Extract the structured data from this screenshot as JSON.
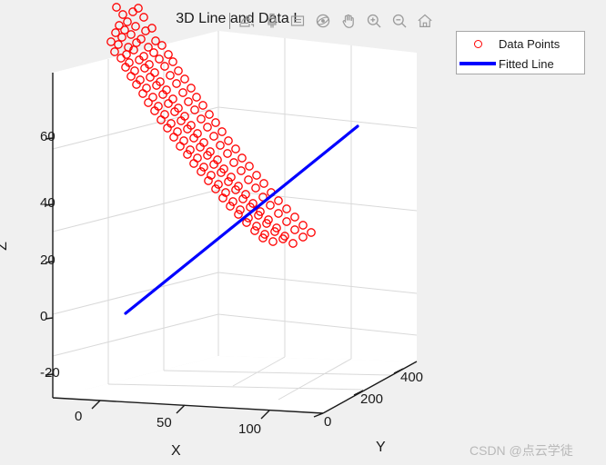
{
  "figure": {
    "background_color": "#f0f0f0",
    "title": "3D Line and Data I"
  },
  "toolbar": {
    "buttons": [
      {
        "name": "export-icon",
        "label": "Export"
      },
      {
        "name": "brush-icon",
        "label": "Brush/Select Data"
      },
      {
        "name": "datatip-icon",
        "label": "Data Tips"
      },
      {
        "name": "rotate3d-icon",
        "label": "Rotate 3D"
      },
      {
        "name": "pan-icon",
        "label": "Pan"
      },
      {
        "name": "zoom-in-icon",
        "label": "Zoom In"
      },
      {
        "name": "zoom-out-icon",
        "label": "Zoom Out"
      },
      {
        "name": "home-icon",
        "label": "Restore View"
      }
    ]
  },
  "legend": {
    "entries": [
      {
        "label": "Data Points",
        "marker": "circle",
        "color": "#ff0000"
      },
      {
        "label": "Fitted Line",
        "marker": "line",
        "color": "#0000ff"
      }
    ]
  },
  "watermark": {
    "text": "CSDN @点云学徒"
  },
  "chart_data": {
    "type": "scatter",
    "title": "3D Line and Data I",
    "xlabel": "X",
    "ylabel": "Y",
    "zlabel": "Z",
    "xlim": [
      -25,
      150
    ],
    "ylim": [
      -100,
      500
    ],
    "zlim": [
      -30,
      75
    ],
    "xticks": [
      0,
      50,
      100
    ],
    "yticks": [
      0,
      200,
      400
    ],
    "zticks": [
      -20,
      0,
      20,
      40,
      60
    ],
    "grid": true,
    "legend_position": "upper right",
    "series": [
      {
        "name": "Data Points",
        "type": "scatter",
        "marker": "o",
        "color": "#ff0000",
        "filled": false,
        "points": [
          [
            128,
            8
          ],
          [
            135,
            16
          ],
          [
            158,
            19
          ],
          [
            146,
            13
          ],
          [
            152,
            9
          ],
          [
            140,
            24
          ],
          [
            131,
            28
          ],
          [
            137,
            33
          ],
          [
            149,
            29
          ],
          [
            160,
            34
          ],
          [
            127,
            36
          ],
          [
            134,
            41
          ],
          [
            144,
            38
          ],
          [
            155,
            43
          ],
          [
            167,
            31
          ],
          [
            122,
            46
          ],
          [
            130,
            49
          ],
          [
            141,
            52
          ],
          [
            150,
            47
          ],
          [
            163,
            52
          ],
          [
            171,
            45
          ],
          [
            126,
            57
          ],
          [
            139,
            60
          ],
          [
            147,
            55
          ],
          [
            158,
            62
          ],
          [
            169,
            58
          ],
          [
            178,
            50
          ],
          [
            133,
            64
          ],
          [
            142,
            69
          ],
          [
            153,
            66
          ],
          [
            164,
            71
          ],
          [
            175,
            65
          ],
          [
            185,
            60
          ],
          [
            138,
            74
          ],
          [
            148,
            78
          ],
          [
            159,
            75
          ],
          [
            170,
            80
          ],
          [
            181,
            73
          ],
          [
            190,
            68
          ],
          [
            144,
            84
          ],
          [
            154,
            88
          ],
          [
            165,
            85
          ],
          [
            176,
            90
          ],
          [
            187,
            83
          ],
          [
            196,
            78
          ],
          [
            150,
            93
          ],
          [
            161,
            97
          ],
          [
            172,
            94
          ],
          [
            183,
            99
          ],
          [
            194,
            92
          ],
          [
            203,
            87
          ],
          [
            157,
            103
          ],
          [
            168,
            107
          ],
          [
            179,
            104
          ],
          [
            190,
            109
          ],
          [
            201,
            102
          ],
          [
            210,
            97
          ],
          [
            163,
            113
          ],
          [
            174,
            117
          ],
          [
            185,
            114
          ],
          [
            196,
            119
          ],
          [
            207,
            112
          ],
          [
            216,
            107
          ],
          [
            170,
            122
          ],
          [
            181,
            126
          ],
          [
            192,
            123
          ],
          [
            203,
            128
          ],
          [
            214,
            121
          ],
          [
            223,
            116
          ],
          [
            177,
            132
          ],
          [
            188,
            136
          ],
          [
            199,
            133
          ],
          [
            210,
            138
          ],
          [
            221,
            131
          ],
          [
            230,
            126
          ],
          [
            184,
            141
          ],
          [
            195,
            145
          ],
          [
            206,
            142
          ],
          [
            217,
            147
          ],
          [
            228,
            140
          ],
          [
            237,
            135
          ],
          [
            191,
            151
          ],
          [
            202,
            155
          ],
          [
            213,
            152
          ],
          [
            224,
            157
          ],
          [
            235,
            150
          ],
          [
            244,
            145
          ],
          [
            198,
            161
          ],
          [
            209,
            165
          ],
          [
            220,
            162
          ],
          [
            231,
            167
          ],
          [
            242,
            160
          ],
          [
            251,
            155
          ],
          [
            206,
            170
          ],
          [
            217,
            174
          ],
          [
            228,
            171
          ],
          [
            239,
            176
          ],
          [
            250,
            169
          ],
          [
            259,
            164
          ],
          [
            213,
            180
          ],
          [
            224,
            184
          ],
          [
            235,
            181
          ],
          [
            246,
            186
          ],
          [
            257,
            179
          ],
          [
            266,
            174
          ],
          [
            221,
            189
          ],
          [
            232,
            193
          ],
          [
            243,
            190
          ],
          [
            254,
            195
          ],
          [
            265,
            188
          ],
          [
            274,
            183
          ],
          [
            229,
            199
          ],
          [
            240,
            203
          ],
          [
            251,
            200
          ],
          [
            262,
            205
          ],
          [
            273,
            198
          ],
          [
            282,
            193
          ],
          [
            237,
            208
          ],
          [
            248,
            212
          ],
          [
            259,
            209
          ],
          [
            270,
            214
          ],
          [
            281,
            207
          ],
          [
            290,
            202
          ],
          [
            245,
            218
          ],
          [
            256,
            222
          ],
          [
            267,
            219
          ],
          [
            278,
            224
          ],
          [
            289,
            217
          ],
          [
            298,
            212
          ],
          [
            253,
            227
          ],
          [
            264,
            231
          ],
          [
            275,
            228
          ],
          [
            286,
            233
          ],
          [
            297,
            226
          ],
          [
            306,
            221
          ],
          [
            262,
            236
          ],
          [
            273,
            240
          ],
          [
            284,
            237
          ],
          [
            295,
            242
          ],
          [
            306,
            235
          ],
          [
            315,
            230
          ],
          [
            271,
            245
          ],
          [
            282,
            249
          ],
          [
            293,
            246
          ],
          [
            304,
            251
          ],
          [
            315,
            244
          ],
          [
            324,
            239
          ],
          [
            280,
            254
          ],
          [
            291,
            258
          ],
          [
            302,
            255
          ],
          [
            313,
            260
          ],
          [
            324,
            253
          ],
          [
            333,
            248
          ],
          [
            289,
            262
          ],
          [
            300,
            266
          ],
          [
            311,
            263
          ],
          [
            322,
            268
          ],
          [
            333,
            261
          ],
          [
            342,
            256
          ]
        ]
      },
      {
        "name": "Fitted Line",
        "type": "line",
        "color": "#0000ff",
        "linewidth": 3.2,
        "endpoints": [
          [
            138,
            345
          ],
          [
            393,
            139
          ]
        ]
      }
    ]
  },
  "axes_geometry": {
    "note": "Projected 2D pixel coordinates of the 3D axes box corners",
    "origin_front": [
      355,
      455
    ],
    "left_front": [
      58,
      438
    ],
    "right_front": [
      458,
      398
    ],
    "left_back_top": [
      58,
      80
    ],
    "description": "MATLAB default 3D view"
  }
}
